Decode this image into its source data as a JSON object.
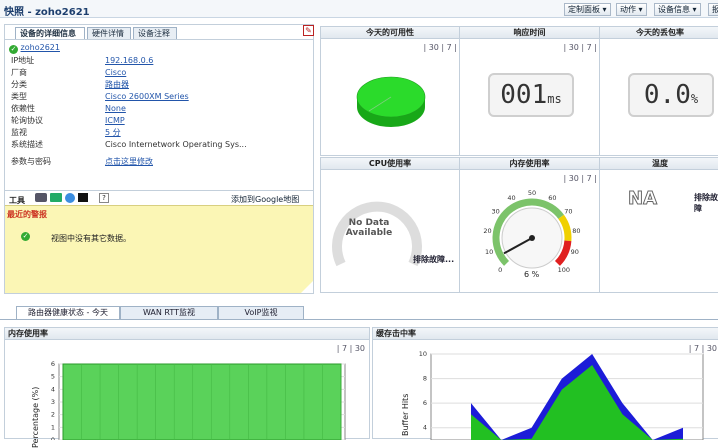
{
  "header": {
    "title": "快照 - zoho2621",
    "menus": [
      "定制面板",
      "动作",
      "设备信息",
      "报"
    ]
  },
  "left": {
    "tabs": [
      "设备的详细信息",
      "硬件详情",
      "设备注释"
    ],
    "device_name": "zoho2621",
    "fields": [
      {
        "label": "IP地址",
        "value": "192.168.0.6",
        "link": true
      },
      {
        "label": "厂商",
        "value": "Cisco",
        "link": true
      },
      {
        "label": "分类",
        "value": "路由器",
        "link": true
      },
      {
        "label": "类型",
        "value": "Cisco 2600XM Series",
        "link": true
      },
      {
        "label": "依赖性",
        "value": "None",
        "link": true
      },
      {
        "label": "轮询协议",
        "value": "ICMP",
        "link": true
      },
      {
        "label": "监视",
        "value": "5   分",
        "link": true
      },
      {
        "label": "系统描述",
        "value": "Cisco Internetwork Operating Sys...",
        "link": false
      },
      {
        "label": "参数与密码",
        "value": "点击这里修改",
        "link": true
      }
    ],
    "tools_label": "工具",
    "google_map": "添加到Google地图",
    "alarm_title": "最近的警报",
    "alarm_text": "视图中没有其它数据。"
  },
  "widgets": {
    "availability": {
      "title": "今天的可用性",
      "ctrl": "| 30 | 7 |"
    },
    "response": {
      "title": "响应时间",
      "ctrl": "| 30 | 7 |",
      "value": "001",
      "unit": "ms"
    },
    "packet_loss": {
      "title": "今天的丢包率",
      "value": "0.0",
      "unit": "%"
    },
    "cpu": {
      "title": "CPU使用率",
      "no_data": "No Data Available",
      "troubleshoot": "排除故障..."
    },
    "memory": {
      "title": "内存使用率",
      "ctrl": "| 30 | 7 |",
      "percent": "6 %",
      "ticks": [
        "0",
        "10",
        "20",
        "30",
        "40",
        "50",
        "60",
        "70",
        "80",
        "90",
        "100"
      ]
    },
    "temp": {
      "title": "温度",
      "value": "NA",
      "troubleshoot": "排除故障"
    }
  },
  "bottom_tabs": [
    "路由器健康状态 - 今天",
    "WAN RTT监视",
    "VoIP监视"
  ],
  "charts": {
    "mem": {
      "title": "内存使用率",
      "ylabel": "Percentage (%)",
      "ctrl": "| 7 | 30"
    },
    "buf": {
      "title": "缓存击中率",
      "ylabel": "Buffer Hits",
      "ctrl": "| 7 | 30"
    }
  },
  "chart_data": [
    {
      "type": "area",
      "title": "内存使用率",
      "ylabel": "Percentage (%)",
      "yticks": [
        "0",
        "1",
        "2",
        "3",
        "4",
        "5",
        "6"
      ],
      "ylim": [
        0,
        6
      ],
      "series": [
        {
          "values": [
            6,
            6,
            6,
            6,
            6,
            6,
            6,
            6,
            6,
            6,
            6,
            6,
            6,
            6,
            6,
            6
          ]
        }
      ]
    },
    {
      "type": "area",
      "title": "缓存击中率",
      "ylabel": "Buffer Hits",
      "yticks": [
        "4",
        "6",
        "8",
        "10"
      ],
      "ylim": [
        3,
        10
      ],
      "series": [
        {
          "values": [
            6,
            3,
            4,
            8,
            10,
            6,
            3,
            4
          ]
        }
      ]
    }
  ]
}
